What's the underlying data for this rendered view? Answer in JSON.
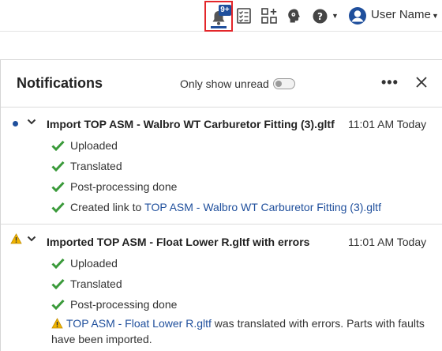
{
  "topbar": {
    "notification_badge": "9+",
    "user_name": "User Name",
    "icons": [
      "bell-icon",
      "checklist-icon",
      "app-grid-icon",
      "learning-head-icon",
      "help-icon",
      "user-avatar-icon"
    ]
  },
  "panel": {
    "title": "Notifications",
    "only_unread_label": "Only show unread",
    "only_unread_on": false
  },
  "notifications": [
    {
      "title": "Import TOP ASM - Walbro WT Carburetor Fitting (3).gltf",
      "time": "11:01 AM Today",
      "status": "unread",
      "steps": [
        "Uploaded",
        "Translated",
        "Post-processing done"
      ],
      "link_prefix": "Created link to ",
      "link_text": "TOP ASM - Walbro WT Carburetor Fitting (3).gltf"
    },
    {
      "title": "Imported TOP ASM - Float Lower R.gltf with errors",
      "time": "11:01 AM Today",
      "status": "warning",
      "steps": [
        "Uploaded",
        "Translated",
        "Post-processing done"
      ],
      "warning_link": "TOP ASM - Float Lower R.gltf",
      "warning_message": " was translated with errors. Parts with faults have been imported."
    }
  ],
  "colors": {
    "accent": "#1f4f9c",
    "success": "#3a9a3a",
    "warning": "#f0b400",
    "highlight": "#e3262a"
  }
}
